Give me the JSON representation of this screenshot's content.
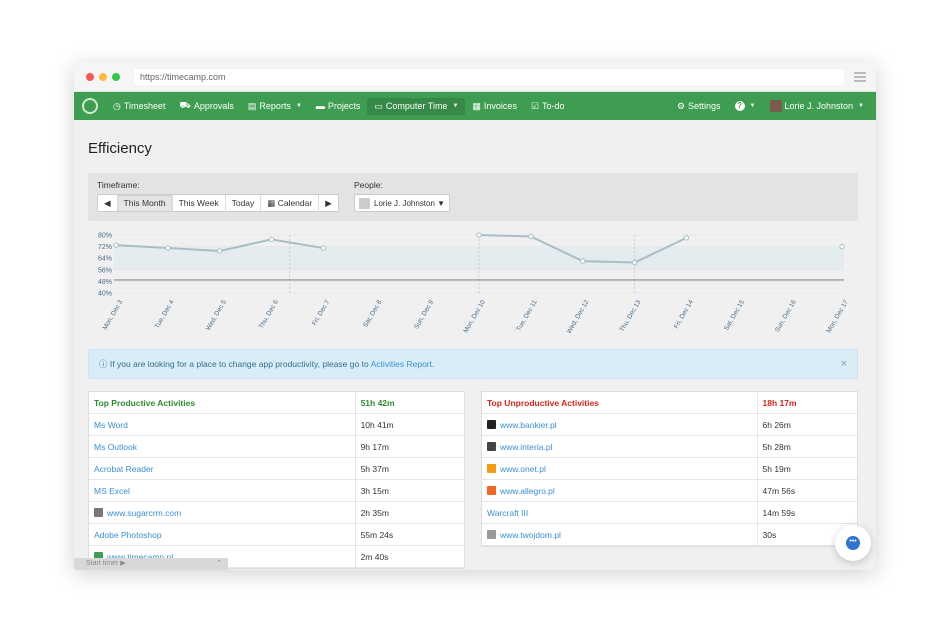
{
  "browser": {
    "url": "https://timecamp.com"
  },
  "nav": {
    "items": [
      {
        "label": "Timesheet",
        "icon": "clock-icon"
      },
      {
        "label": "Approvals",
        "icon": "car-icon"
      },
      {
        "label": "Reports",
        "icon": "document-icon"
      },
      {
        "label": "Projects",
        "icon": "folder-icon"
      },
      {
        "label": "Computer Time",
        "icon": "laptop-icon"
      },
      {
        "label": "Invoices",
        "icon": "invoice-icon"
      },
      {
        "label": "To-do",
        "icon": "checkbox-icon"
      }
    ],
    "settings": "Settings",
    "help": "?",
    "user": "Lorie J. Johnston"
  },
  "page": {
    "title": "Efficiency"
  },
  "filters": {
    "timeframe_label": "Timeframe:",
    "prev": "◀",
    "this_month": "This Month",
    "this_week": "This Week",
    "today": "Today",
    "calendar": "Calendar",
    "next": "▶",
    "people_label": "People:",
    "person": "Lorie J. Johnston ▼"
  },
  "chart_data": {
    "type": "line",
    "y_ticks": [
      "80%",
      "72%",
      "64%",
      "56%",
      "48%",
      "40%"
    ],
    "ylim": [
      40,
      80
    ],
    "categories": [
      "Mon, Dec 3",
      "Tue, Dec 4",
      "Wed, Dec 5",
      "Thu, Dec 6",
      "Fri, Dec 7",
      "Sat, Dec 8",
      "Sun, Dec 9",
      "Mon, Dec 10",
      "Tue, Dec 11",
      "Wed, Dec 12",
      "Thu, Dec 13",
      "Fri, Dec 14",
      "Sat, Dec 15",
      "Sun, Dec 16",
      "Mon, Dec 17"
    ],
    "values": [
      73,
      71,
      69,
      77,
      71,
      null,
      null,
      80,
      79,
      62,
      61,
      78,
      null,
      null,
      72
    ],
    "band": [
      56,
      72
    ],
    "reference": 49,
    "colors": {
      "line": "#a7bfc4",
      "band": "#e4ecef",
      "reference": "#7f8f8a"
    }
  },
  "alert": {
    "text": "If you are looking for a place to change app productivity, please go to",
    "link": "Activities Report",
    "end": ".",
    "close": "×"
  },
  "productive": {
    "title": "Top Productive Activities",
    "total": "51h 42m",
    "color": "#2e8b2e",
    "rows": [
      {
        "name": "Ms Word",
        "time": "10h 41m"
      },
      {
        "name": "Ms Outlook",
        "time": "9h 17m"
      },
      {
        "name": "Acrobat Reader",
        "time": "5h 37m"
      },
      {
        "name": "MS Excel",
        "time": "3h 15m"
      },
      {
        "name": "www.sugarcrm.com",
        "time": "2h 35m"
      },
      {
        "name": "Adobe Photoshop",
        "time": "55m 24s"
      },
      {
        "name": "www.timecamp.pl",
        "time": "2m 40s"
      }
    ]
  },
  "unproductive": {
    "title": "Top Unproductive Activities",
    "total": "18h 17m",
    "color": "#d9261c",
    "rows": [
      {
        "name": "www.bankier.pl",
        "time": "6h 26m"
      },
      {
        "name": "www.interia.pl",
        "time": "5h 28m"
      },
      {
        "name": "www.onet.pl",
        "time": "5h 19m"
      },
      {
        "name": "www.allegro.pl",
        "time": "47m 56s"
      },
      {
        "name": "Warcraft III",
        "time": "14m 59s"
      },
      {
        "name": "www.twojdom.pl",
        "time": "30s"
      }
    ]
  },
  "timer": {
    "label": "Start timer ▶",
    "toggle": "⌃"
  }
}
